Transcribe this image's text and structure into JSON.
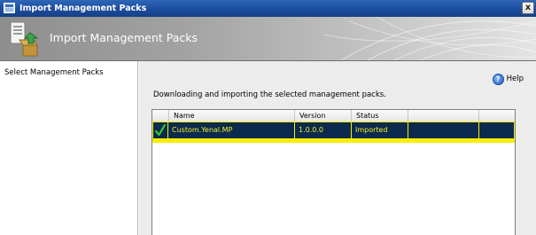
{
  "window": {
    "title": "Import Management Packs",
    "close_glyph": "x"
  },
  "banner": {
    "title": "Import Management Packs"
  },
  "left_pane": {
    "steps": [
      {
        "label": "Select Management Packs"
      }
    ]
  },
  "main": {
    "help_label": "Help",
    "description": "Downloading and importing the selected management packs.",
    "table": {
      "columns": [
        "Name",
        "Version",
        "Status"
      ],
      "rows": [
        {
          "icon": "checkmark-icon",
          "name": "Custom.Yenal.MP",
          "version": "1.0.0.0",
          "status": "Imported"
        }
      ]
    }
  },
  "colors": {
    "selection_background": "#0b2a4d",
    "selection_text": "#f4ee2a",
    "checkmark": "#33cc33",
    "titlebar": "#1d4e9f"
  }
}
